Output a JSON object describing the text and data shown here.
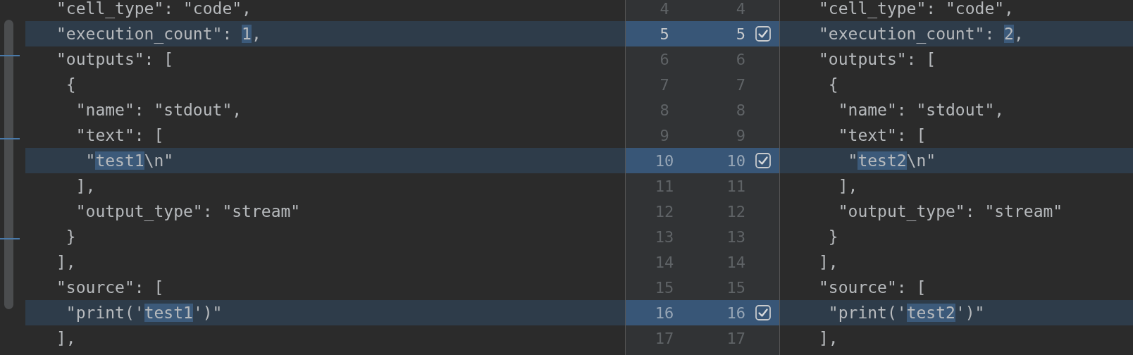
{
  "left_pane": {
    "lines": [
      {
        "changed": false,
        "segments": [
          {
            "text": "\"cell_type\": \"code\",",
            "changed": false
          }
        ]
      },
      {
        "changed": true,
        "segments": [
          {
            "text": "\"execution_count\": ",
            "changed": false
          },
          {
            "text": "1",
            "changed": true
          },
          {
            "text": ",",
            "changed": false
          }
        ]
      },
      {
        "changed": false,
        "segments": [
          {
            "text": "\"outputs\": [",
            "changed": false
          }
        ]
      },
      {
        "changed": false,
        "segments": [
          {
            "text": " {",
            "changed": false
          }
        ]
      },
      {
        "changed": false,
        "segments": [
          {
            "text": "  \"name\": \"stdout\",",
            "changed": false
          }
        ]
      },
      {
        "changed": false,
        "segments": [
          {
            "text": "  \"text\": [",
            "changed": false
          }
        ]
      },
      {
        "changed": true,
        "segments": [
          {
            "text": "   \"",
            "changed": false
          },
          {
            "text": "test1",
            "changed": true
          },
          {
            "text": "\\n\"",
            "changed": false
          }
        ]
      },
      {
        "changed": false,
        "segments": [
          {
            "text": "  ],",
            "changed": false
          }
        ]
      },
      {
        "changed": false,
        "segments": [
          {
            "text": "  \"output_type\": \"stream\"",
            "changed": false
          }
        ]
      },
      {
        "changed": false,
        "segments": [
          {
            "text": " }",
            "changed": false
          }
        ]
      },
      {
        "changed": false,
        "segments": [
          {
            "text": "],",
            "changed": false
          }
        ]
      },
      {
        "changed": false,
        "segments": [
          {
            "text": "\"source\": [",
            "changed": false
          }
        ]
      },
      {
        "changed": true,
        "segments": [
          {
            "text": " \"print('",
            "changed": false
          },
          {
            "text": "test1",
            "changed": true
          },
          {
            "text": "')\"",
            "changed": false
          }
        ]
      },
      {
        "changed": false,
        "segments": [
          {
            "text": "],",
            "changed": false
          }
        ]
      }
    ]
  },
  "gutter": {
    "rows": [
      {
        "left_number": "4",
        "right_number": "4",
        "changed": false,
        "current": false
      },
      {
        "left_number": "5",
        "right_number": "5",
        "changed": true,
        "current": true,
        "checked": true
      },
      {
        "left_number": "6",
        "right_number": "6",
        "changed": false,
        "current": false
      },
      {
        "left_number": "7",
        "right_number": "7",
        "changed": false,
        "current": false
      },
      {
        "left_number": "8",
        "right_number": "8",
        "changed": false,
        "current": false
      },
      {
        "left_number": "9",
        "right_number": "9",
        "changed": false,
        "current": false
      },
      {
        "left_number": "10",
        "right_number": "10",
        "changed": true,
        "current": false,
        "checked": true
      },
      {
        "left_number": "11",
        "right_number": "11",
        "changed": false,
        "current": false
      },
      {
        "left_number": "12",
        "right_number": "12",
        "changed": false,
        "current": false
      },
      {
        "left_number": "13",
        "right_number": "13",
        "changed": false,
        "current": false
      },
      {
        "left_number": "14",
        "right_number": "14",
        "changed": false,
        "current": false
      },
      {
        "left_number": "15",
        "right_number": "15",
        "changed": false,
        "current": false
      },
      {
        "left_number": "16",
        "right_number": "16",
        "changed": true,
        "current": false,
        "checked": true
      },
      {
        "left_number": "17",
        "right_number": "17",
        "changed": false,
        "current": false
      }
    ]
  },
  "right_pane": {
    "lines": [
      {
        "changed": false,
        "segments": [
          {
            "text": "\"cell_type\": \"code\",",
            "changed": false
          }
        ]
      },
      {
        "changed": true,
        "segments": [
          {
            "text": "\"execution_count\": ",
            "changed": false
          },
          {
            "text": "2",
            "changed": true
          },
          {
            "text": ",",
            "changed": false
          }
        ]
      },
      {
        "changed": false,
        "segments": [
          {
            "text": "\"outputs\": [",
            "changed": false
          }
        ]
      },
      {
        "changed": false,
        "segments": [
          {
            "text": " {",
            "changed": false
          }
        ]
      },
      {
        "changed": false,
        "segments": [
          {
            "text": "  \"name\": \"stdout\",",
            "changed": false
          }
        ]
      },
      {
        "changed": false,
        "segments": [
          {
            "text": "  \"text\": [",
            "changed": false
          }
        ]
      },
      {
        "changed": true,
        "segments": [
          {
            "text": "   \"",
            "changed": false
          },
          {
            "text": "test2",
            "changed": true
          },
          {
            "text": "\\n\"",
            "changed": false
          }
        ]
      },
      {
        "changed": false,
        "segments": [
          {
            "text": "  ],",
            "changed": false
          }
        ]
      },
      {
        "changed": false,
        "segments": [
          {
            "text": "  \"output_type\": \"stream\"",
            "changed": false
          }
        ]
      },
      {
        "changed": false,
        "segments": [
          {
            "text": " }",
            "changed": false
          }
        ]
      },
      {
        "changed": false,
        "segments": [
          {
            "text": "],",
            "changed": false
          }
        ]
      },
      {
        "changed": false,
        "segments": [
          {
            "text": "\"source\": [",
            "changed": false
          }
        ]
      },
      {
        "changed": true,
        "segments": [
          {
            "text": " \"print('",
            "changed": false
          },
          {
            "text": "test2",
            "changed": true
          },
          {
            "text": "')\"",
            "changed": false
          }
        ]
      },
      {
        "changed": false,
        "segments": [
          {
            "text": "],",
            "changed": false
          }
        ]
      }
    ]
  }
}
